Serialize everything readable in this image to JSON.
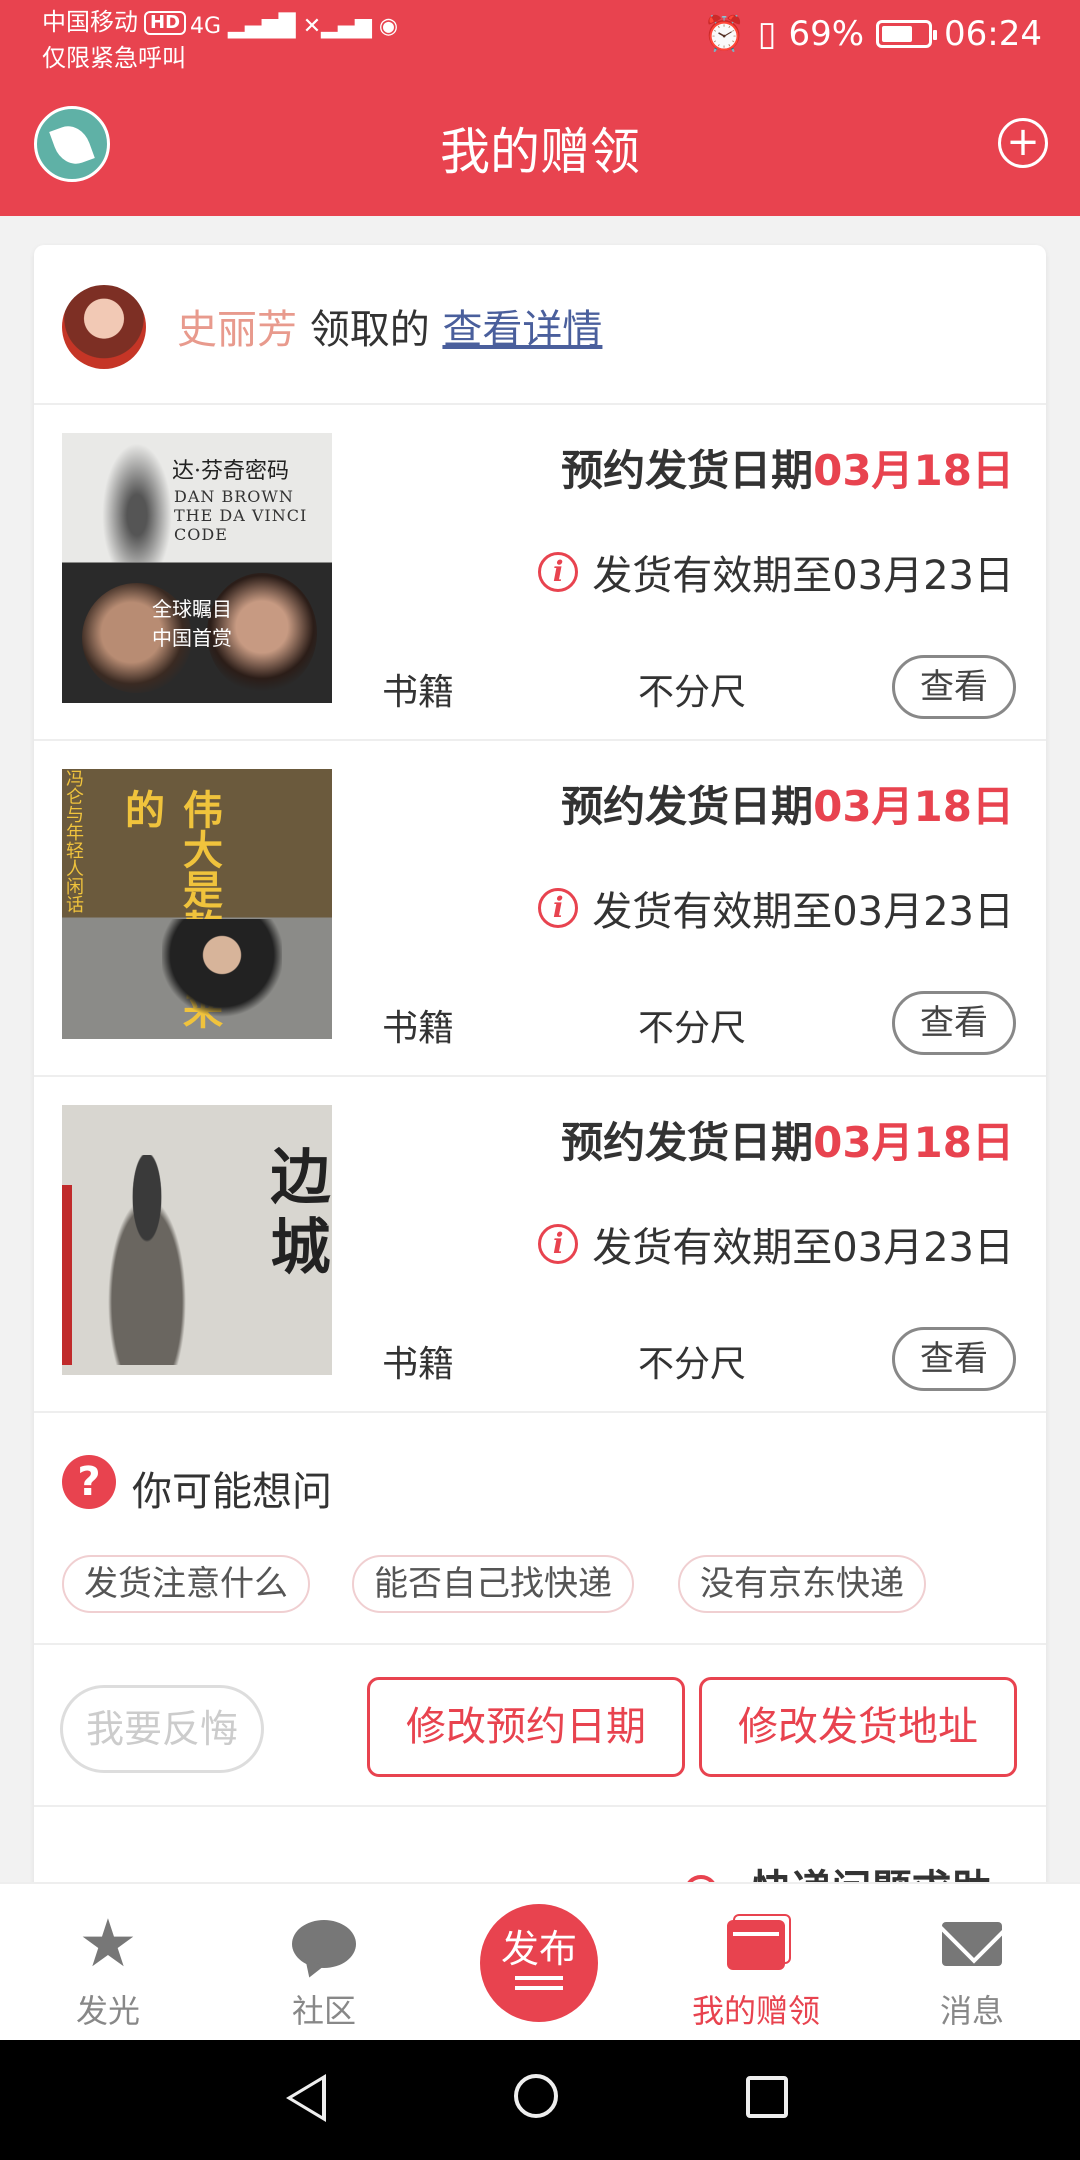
{
  "status_bar": {
    "carrier": "中国移动",
    "hd": "HD",
    "emergency": "仅限紧急呼叫",
    "signal": "4G",
    "battery_percent": "69%",
    "battery_level": 0.69,
    "time": "06:24"
  },
  "header": {
    "title": "我的赠领",
    "add_icon": "plus-circle-icon",
    "logo_icon": "leaf-logo-icon"
  },
  "owner": {
    "name": "史丽芳",
    "action": "领取的",
    "link": "查看详情"
  },
  "items": [
    {
      "cover_text": [
        "达·芬奇密码",
        "DAN BROWN THE DA VINCI CODE",
        "全球瞩目 中国首赏"
      ],
      "ship_label": "预约发货日期",
      "ship_date": "03月18日",
      "validity": "发货有效期至03月23日",
      "category": "书籍",
      "size": "不分尺",
      "view": "查看"
    },
    {
      "cover_text": [
        "伟大是熬出来的",
        "冯仑与年轻人闲话人生"
      ],
      "ship_label": "预约发货日期",
      "ship_date": "03月18日",
      "validity": "发货有效期至03月23日",
      "category": "书籍",
      "size": "不分尺",
      "view": "查看"
    },
    {
      "cover_text": [
        "边城"
      ],
      "ship_label": "预约发货日期",
      "ship_date": "03月18日",
      "validity": "发货有效期至03月23日",
      "category": "书籍",
      "size": "不分尺",
      "view": "查看"
    }
  ],
  "faq": {
    "title": "你可能想问",
    "chips": [
      "发货注意什么",
      "能否自己找快递",
      "没有京东快递"
    ]
  },
  "actions": {
    "regret": "我要反悔",
    "change_date": "修改预约日期",
    "change_address": "修改发货地址"
  },
  "help": {
    "label": "快递问题求助"
  },
  "bottom_nav": [
    {
      "label": "发光",
      "icon": "star-icon"
    },
    {
      "label": "社区",
      "icon": "chat-bubble-icon"
    },
    {
      "label": "发布",
      "icon": "publish-button"
    },
    {
      "label": "我的赠领",
      "icon": "gift-box-icon",
      "active": true
    },
    {
      "label": "消息",
      "icon": "mail-icon"
    }
  ],
  "colors": {
    "primary": "#e8434f",
    "link": "#4a5f9c",
    "owner_name": "#e89a8d"
  }
}
